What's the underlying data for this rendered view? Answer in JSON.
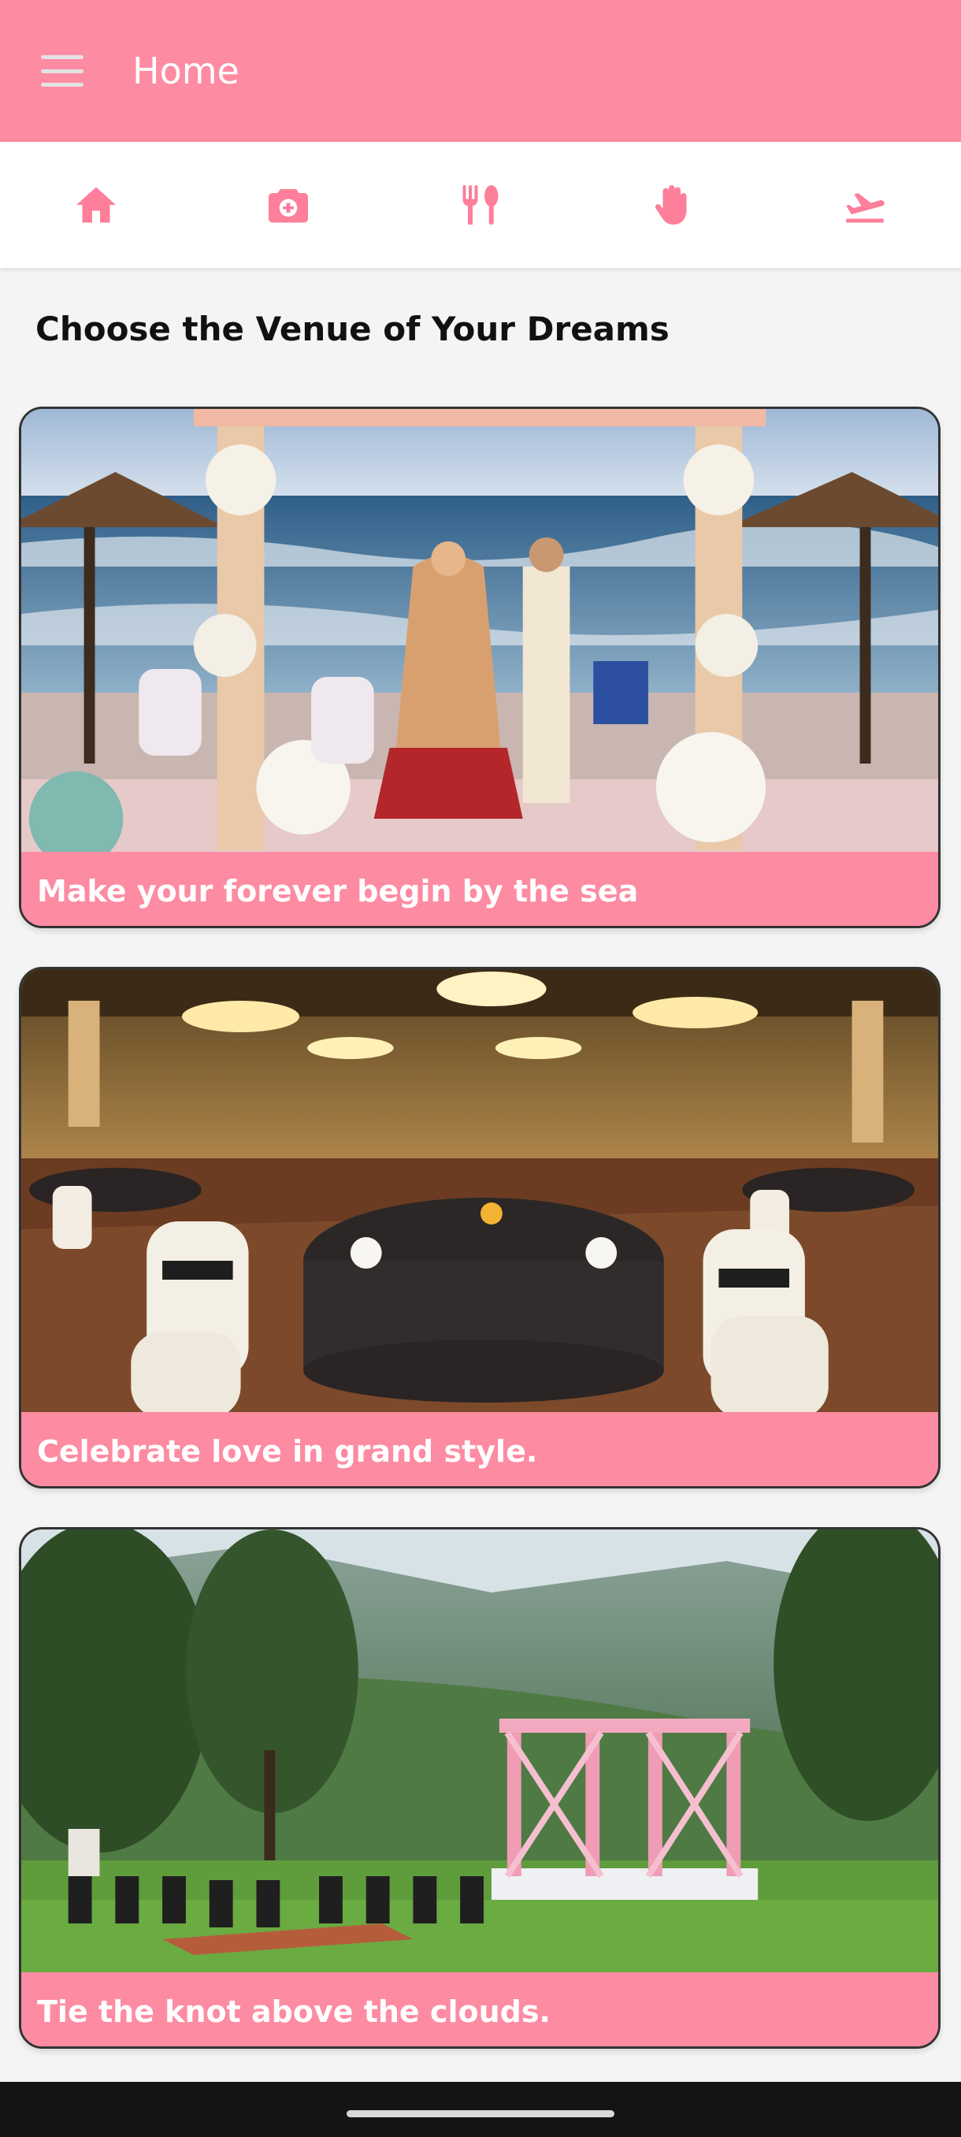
{
  "colors": {
    "accent": "#fd8ba2",
    "icon": "#fd7f9a",
    "title_text": "#111111"
  },
  "appbar": {
    "title": "Home",
    "menu_icon": "hamburger-menu-icon"
  },
  "tabs": [
    {
      "icon": "home-icon"
    },
    {
      "icon": "camera-icon"
    },
    {
      "icon": "fork-knife-icon"
    },
    {
      "icon": "hand-icon"
    },
    {
      "icon": "airplane-takeoff-icon"
    }
  ],
  "section": {
    "title": "Choose the Venue of Your Dreams"
  },
  "venues": [
    {
      "caption": "Make your forever begin by the sea",
      "image": "beach-wedding-mandap-photo"
    },
    {
      "caption": "Celebrate love in grand style.",
      "image": "banquet-hall-photo"
    },
    {
      "caption": "Tie the knot above the clouds.",
      "image": "mountain-lawn-wedding-photo"
    }
  ]
}
